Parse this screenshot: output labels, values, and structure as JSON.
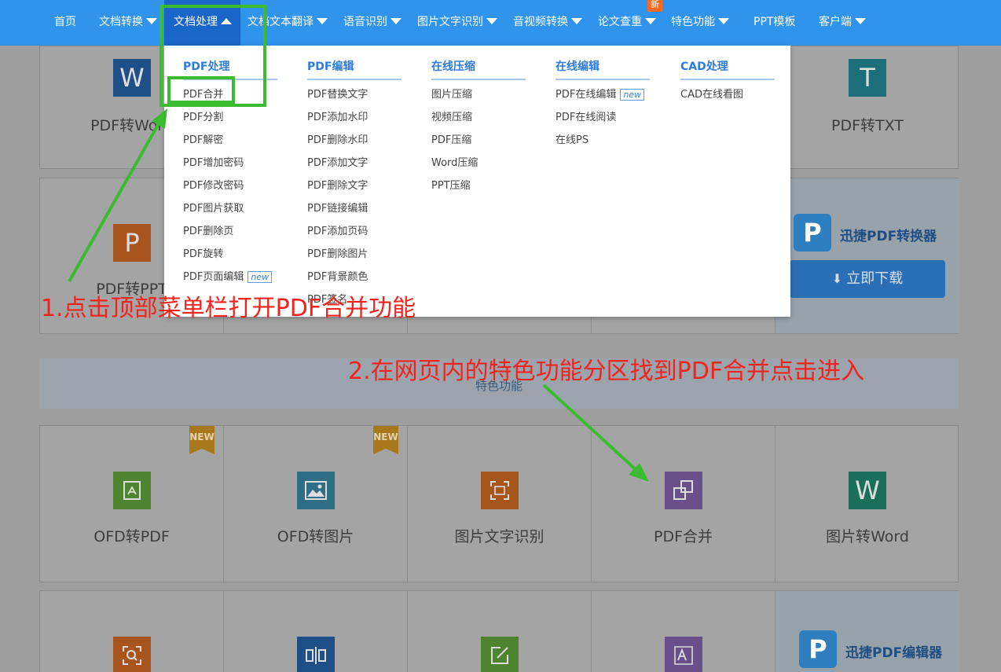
{
  "nav": {
    "items": [
      {
        "label": "首页",
        "dropdown": false
      },
      {
        "label": "文档转换",
        "dropdown": true
      },
      {
        "label": "文档处理",
        "dropdown": true,
        "active": true
      },
      {
        "label": "文档文本翻译",
        "dropdown": true
      },
      {
        "label": "语音识别",
        "dropdown": true
      },
      {
        "label": "图片文字识别",
        "dropdown": true
      },
      {
        "label": "音视频转换",
        "dropdown": true
      },
      {
        "label": "论文查重",
        "dropdown": true,
        "badge": "新"
      },
      {
        "label": "特色功能",
        "dropdown": true
      },
      {
        "label": "PPT模板",
        "dropdown": false
      },
      {
        "label": "客户端",
        "dropdown": true
      }
    ]
  },
  "dropdown": {
    "columns": [
      {
        "heading": "PDF处理",
        "items": [
          {
            "label": "PDF合并"
          },
          {
            "label": "PDF分割"
          },
          {
            "label": "PDF解密"
          },
          {
            "label": "PDF增加密码"
          },
          {
            "label": "PDF修改密码"
          },
          {
            "label": "PDF图片获取"
          },
          {
            "label": "PDF删除页"
          },
          {
            "label": "PDF旋转"
          },
          {
            "label": "PDF页面编辑",
            "new": "new"
          }
        ]
      },
      {
        "heading": "PDF编辑",
        "items": [
          {
            "label": "PDF替换文字"
          },
          {
            "label": "PDF添加水印"
          },
          {
            "label": "PDF删除水印"
          },
          {
            "label": "PDF添加文字"
          },
          {
            "label": "PDF删除文字"
          },
          {
            "label": "PDF链接编辑"
          },
          {
            "label": "PDF添加页码"
          },
          {
            "label": "PDF删除图片"
          },
          {
            "label": "PDF背景颜色"
          },
          {
            "label": "PDF签名"
          }
        ]
      },
      {
        "heading": "在线压缩",
        "items": [
          {
            "label": "图片压缩"
          },
          {
            "label": "视频压缩"
          },
          {
            "label": "PDF压缩"
          },
          {
            "label": "Word压缩"
          },
          {
            "label": "PPT压缩"
          }
        ]
      },
      {
        "heading": "在线编辑",
        "items": [
          {
            "label": "PDF在线编辑",
            "new": "new"
          },
          {
            "label": "PDF在线阅读"
          },
          {
            "label": "在线PS"
          }
        ]
      },
      {
        "heading": "CAD处理",
        "items": [
          {
            "label": "CAD在线看图"
          }
        ]
      }
    ]
  },
  "page": {
    "row1": [
      {
        "icon": "W",
        "label": "PDF转Word",
        "color": "#1e4f86"
      },
      {
        "icon": "",
        "label": "",
        "color": ""
      },
      {
        "icon": "",
        "label": "",
        "color": ""
      },
      {
        "icon": "",
        "label": "",
        "color": ""
      },
      {
        "icon": "T",
        "label": "PDF转TXT",
        "color": "#1a6f7a"
      }
    ],
    "row2_first": {
      "icon": "P",
      "label": "PDF转PPT",
      "color": "#a8551d"
    },
    "promo1": {
      "title": "迅捷PDF转换器",
      "button": "立即下载",
      "logo": "P"
    },
    "special_band": "特色功能",
    "row3": [
      {
        "icon": "ofd-pdf",
        "label": "OFD转PDF",
        "color": "#4e8430",
        "new": "NEW"
      },
      {
        "icon": "image",
        "label": "OFD转图片",
        "color": "#2f6f86",
        "new": "NEW"
      },
      {
        "icon": "scan-text",
        "label": "图片文字识别",
        "color": "#a8551d"
      },
      {
        "icon": "merge",
        "label": "PDF合并",
        "color": "#6a4f8a"
      },
      {
        "icon": "W",
        "label": "图片转Word",
        "color": "#1a6f5a"
      }
    ],
    "row4": [
      {
        "icon": "search-doc",
        "color": "#a8551d"
      },
      {
        "icon": "split",
        "color": "#1e4f86"
      },
      {
        "icon": "edit",
        "color": "#4e8430"
      },
      {
        "icon": "font",
        "color": "#6a4f8a"
      }
    ],
    "promo2": {
      "title": "迅捷PDF编辑器",
      "logo": "P",
      "sublogo": "PDF"
    }
  },
  "annotations": {
    "note1": "1.点击顶部菜单栏打开PDF合并功能",
    "note2": "2.在网页内的特色功能分区找到PDF合并点击进入"
  }
}
